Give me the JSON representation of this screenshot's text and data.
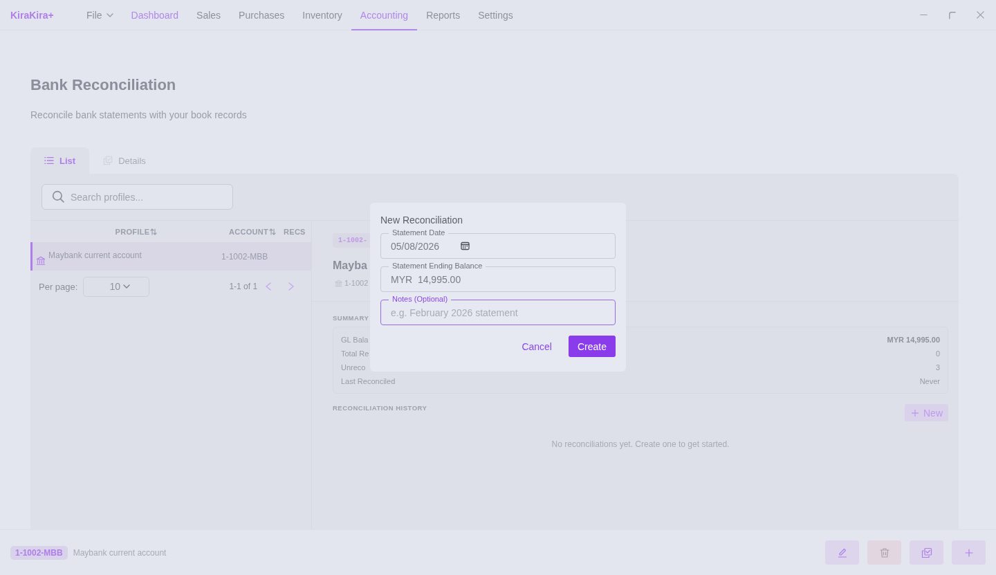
{
  "app": {
    "logo": "KiraKira+",
    "menu": [
      {
        "label": "File",
        "kind": "dropdown",
        "selected": false,
        "hovered": false
      },
      {
        "label": "Dashboard",
        "kind": "link",
        "selected": false,
        "hovered": true
      },
      {
        "label": "Sales",
        "kind": "link",
        "selected": false,
        "hovered": false
      },
      {
        "label": "Purchases",
        "kind": "link",
        "selected": false,
        "hovered": false
      },
      {
        "label": "Inventory",
        "kind": "link",
        "selected": false,
        "hovered": false
      },
      {
        "label": "Accounting",
        "kind": "link",
        "selected": true,
        "hovered": false
      },
      {
        "label": "Reports",
        "kind": "link",
        "selected": false,
        "hovered": false
      },
      {
        "label": "Settings",
        "kind": "link",
        "selected": false,
        "hovered": false
      }
    ]
  },
  "page": {
    "title": "Bank Reconciliation",
    "subtitle": "Reconcile bank statements with your book records"
  },
  "tabs": [
    {
      "label": "List",
      "kind": "list",
      "selected": true,
      "disabled": false
    },
    {
      "label": "Details",
      "kind": "details",
      "selected": false,
      "disabled": true
    }
  ],
  "search": {
    "placeholder": "Search profiles..."
  },
  "table": {
    "columns": [
      {
        "label": "PROFILE",
        "sortable": true
      },
      {
        "label": "ACCOUNT",
        "sortable": true
      },
      {
        "label": "RECS",
        "sortable": false
      }
    ],
    "rows": [
      {
        "profile": "Maybank current account",
        "account": "1-1002-MBB",
        "selected": true
      }
    ]
  },
  "pagination": {
    "per_page_label": "Per page:",
    "per_page": "10",
    "range": "1-1 of 1"
  },
  "detail": {
    "badge": "1-1002-",
    "title": "Mayba",
    "account": "1-1002",
    "summary_heading": "SUMMARY",
    "summary": [
      {
        "label": "GL Bala",
        "value": "MYR 14,995.00",
        "emphasis": true
      },
      {
        "label": "Total Re",
        "value": "0",
        "emphasis": false
      },
      {
        "label": "Unreco",
        "value": "3",
        "emphasis": false
      },
      {
        "label": "Last Reconciled",
        "value": "Never",
        "emphasis": false
      }
    ],
    "history_heading": "RECONCILIATION HISTORY",
    "new_button": "New",
    "empty_message": "No reconciliations yet. Create one to get started."
  },
  "dialog": {
    "title": "New Reconciliation",
    "fields": [
      {
        "label": "Statement Date",
        "kind": "date",
        "value": "05/08/2026",
        "focused": false
      },
      {
        "label": "Statement Ending Balance",
        "kind": "text",
        "value": "MYR  14,995.00",
        "focused": false
      },
      {
        "label": "Notes (Optional)",
        "kind": "text",
        "placeholder": "e.g. February 2026 statement",
        "focused": true
      }
    ],
    "cancel": "Cancel",
    "create": "Create"
  },
  "footer": {
    "badge": "1-1002-MBB",
    "name": "Maybank current account",
    "actions": [
      {
        "kind": "edit"
      },
      {
        "kind": "delete"
      },
      {
        "kind": "copy"
      },
      {
        "kind": "add"
      }
    ]
  }
}
